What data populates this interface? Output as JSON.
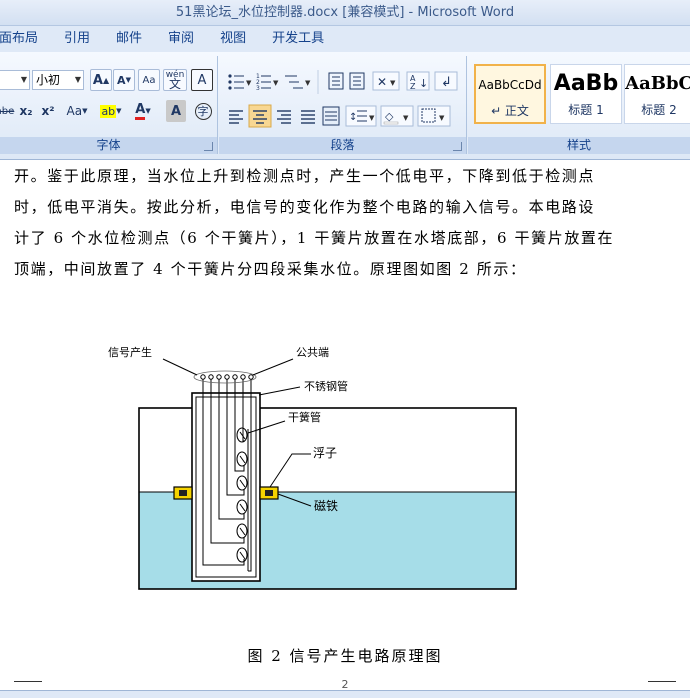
{
  "window": {
    "title": "51黑论坛_水位控制器.docx [兼容模式] - Microsoft Word"
  },
  "menu": {
    "tabs": [
      "面布局",
      "引用",
      "邮件",
      "审阅",
      "视图",
      "开发工具"
    ]
  },
  "ribbon": {
    "font_group": {
      "label": "字体",
      "font_size": "小初",
      "grow_font": "A",
      "shrink_font": "A",
      "clear_format": "Aa",
      "phonetic": "wén",
      "char_border": "A",
      "strike": "abe",
      "subscript": "x₂",
      "superscript": "x²",
      "change_case": "Aa",
      "highlight": "ab",
      "font_color": "A",
      "char_shading": "A",
      "enclose": "字"
    },
    "paragraph_group": {
      "label": "段落"
    },
    "styles_group": {
      "label": "样式",
      "styles": [
        {
          "sample": "AaBbCcDd",
          "name": "↵ 正文"
        },
        {
          "sample": "AaBb",
          "name": "标题 1"
        },
        {
          "sample": "AaBbC",
          "name": "标题 2"
        }
      ]
    }
  },
  "document": {
    "paragraph_lines": [
      "开。鉴于此原理，当水位上升到检测点时，产生一个低电平，下降到低于检测点",
      "时，低电平消失。按此分析，电信号的变化作为整个电路的输入信号。本电路设",
      "计了 6 个水位检测点（6 个干簧片），1 干簧片放置在水塔底部，6 干簧片放置在",
      "顶端，中间放置了 4 个干簧片分四段采集水位。原理图如图 2 所示："
    ],
    "figure": {
      "labels": {
        "signal": "信号产生",
        "common": "公共端",
        "steel_pipe": "不锈钢管",
        "reed": "干簧管",
        "float": "浮子",
        "magnet": "磁铁"
      },
      "caption": "图 2 信号产生电路原理图"
    },
    "page_number": "2"
  },
  "colors": {
    "water": "#a6dde8",
    "magnet": "#f5d300",
    "ribbon_active": "#f8d792"
  }
}
